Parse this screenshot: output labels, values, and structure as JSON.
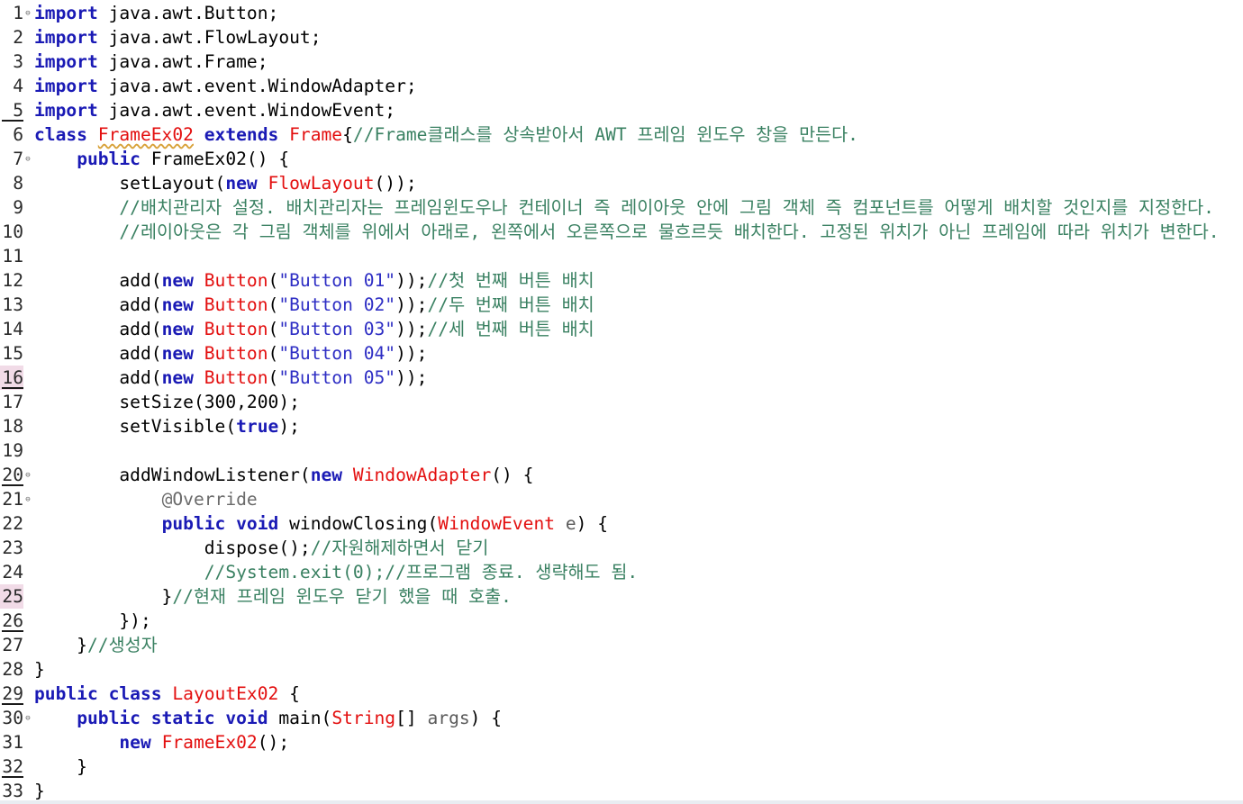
{
  "editor": {
    "language": "java",
    "lines": [
      {
        "n": "1",
        "fold": true,
        "segs": [
          {
            "t": "import",
            "c": "kw"
          },
          {
            "t": " java.awt.Button;",
            "c": ""
          }
        ]
      },
      {
        "n": "2",
        "segs": [
          {
            "t": "import",
            "c": "kw"
          },
          {
            "t": " java.awt.FlowLayout;",
            "c": ""
          }
        ]
      },
      {
        "n": "3",
        "segs": [
          {
            "t": "import",
            "c": "kw"
          },
          {
            "t": " java.awt.Frame;",
            "c": ""
          }
        ]
      },
      {
        "n": "4",
        "segs": [
          {
            "t": "import",
            "c": "kw"
          },
          {
            "t": " java.awt.event.WindowAdapter;",
            "c": ""
          }
        ]
      },
      {
        "n": "5",
        "underline": true,
        "segs": [
          {
            "t": "import",
            "c": "kw"
          },
          {
            "t": " java.awt.event.WindowEvent;",
            "c": ""
          }
        ]
      },
      {
        "n": "6",
        "segs": [
          {
            "t": "class",
            "c": "kw"
          },
          {
            "t": " ",
            "c": ""
          },
          {
            "t": "FrameEx02",
            "c": "ty err"
          },
          {
            "t": " ",
            "c": ""
          },
          {
            "t": "extends",
            "c": "kw"
          },
          {
            "t": " ",
            "c": ""
          },
          {
            "t": "Frame",
            "c": "ty"
          },
          {
            "t": "{",
            "c": ""
          },
          {
            "t": "//Frame클래스를 상속받아서 AWT 프레임 윈도우 창을 만든다.",
            "c": "cm"
          }
        ]
      },
      {
        "n": "7",
        "fold": true,
        "segs": [
          {
            "t": "    ",
            "c": ""
          },
          {
            "t": "public",
            "c": "kw"
          },
          {
            "t": " FrameEx02() {",
            "c": ""
          }
        ]
      },
      {
        "n": "8",
        "segs": [
          {
            "t": "        setLayout(",
            "c": ""
          },
          {
            "t": "new",
            "c": "kw"
          },
          {
            "t": " ",
            "c": ""
          },
          {
            "t": "FlowLayout",
            "c": "ty"
          },
          {
            "t": "());",
            "c": ""
          }
        ]
      },
      {
        "n": "9",
        "segs": [
          {
            "t": "        ",
            "c": ""
          },
          {
            "t": "//배치관리자 설정. 배치관리자는 프레임윈도우나 컨테이너 즉 레이아웃 안에 그림 객체 즉 컴포넌트를 어떻게 배치할 것인지를 지정한다.",
            "c": "cm"
          }
        ]
      },
      {
        "n": "10",
        "segs": [
          {
            "t": "        ",
            "c": ""
          },
          {
            "t": "//레이아웃은 각 그림 객체를 위에서 아래로, 왼쪽에서 오른쪽으로 물흐르듯 배치한다. 고정된 위치가 아닌 프레임에 따라 위치가 변한다.",
            "c": "cm"
          }
        ]
      },
      {
        "n": "11",
        "segs": []
      },
      {
        "n": "12",
        "segs": [
          {
            "t": "        add(",
            "c": ""
          },
          {
            "t": "new",
            "c": "kw"
          },
          {
            "t": " ",
            "c": ""
          },
          {
            "t": "Button",
            "c": "ty"
          },
          {
            "t": "(",
            "c": ""
          },
          {
            "t": "\"Button 01\"",
            "c": "st"
          },
          {
            "t": "));",
            "c": ""
          },
          {
            "t": "//첫 번째 버튼 배치",
            "c": "cm"
          }
        ]
      },
      {
        "n": "13",
        "segs": [
          {
            "t": "        add(",
            "c": ""
          },
          {
            "t": "new",
            "c": "kw"
          },
          {
            "t": " ",
            "c": ""
          },
          {
            "t": "Button",
            "c": "ty"
          },
          {
            "t": "(",
            "c": ""
          },
          {
            "t": "\"Button 02\"",
            "c": "st"
          },
          {
            "t": "));",
            "c": ""
          },
          {
            "t": "//두 번째 버튼 배치",
            "c": "cm"
          }
        ]
      },
      {
        "n": "14",
        "segs": [
          {
            "t": "        add(",
            "c": ""
          },
          {
            "t": "new",
            "c": "kw"
          },
          {
            "t": " ",
            "c": ""
          },
          {
            "t": "Button",
            "c": "ty"
          },
          {
            "t": "(",
            "c": ""
          },
          {
            "t": "\"Button 03\"",
            "c": "st"
          },
          {
            "t": "));",
            "c": ""
          },
          {
            "t": "//세 번째 버튼 배치",
            "c": "cm"
          }
        ]
      },
      {
        "n": "15",
        "segs": [
          {
            "t": "        add(",
            "c": ""
          },
          {
            "t": "new",
            "c": "kw"
          },
          {
            "t": " ",
            "c": ""
          },
          {
            "t": "Button",
            "c": "ty"
          },
          {
            "t": "(",
            "c": ""
          },
          {
            "t": "\"Button 04\"",
            "c": "st"
          },
          {
            "t": "));",
            "c": ""
          }
        ]
      },
      {
        "n": "16",
        "bookmark": true,
        "underline": true,
        "segs": [
          {
            "t": "        add(",
            "c": ""
          },
          {
            "t": "new",
            "c": "kw"
          },
          {
            "t": " ",
            "c": ""
          },
          {
            "t": "Button",
            "c": "ty"
          },
          {
            "t": "(",
            "c": ""
          },
          {
            "t": "\"Button 05\"",
            "c": "st"
          },
          {
            "t": "));",
            "c": ""
          }
        ]
      },
      {
        "n": "17",
        "segs": [
          {
            "t": "        setSize(300,200);",
            "c": ""
          }
        ]
      },
      {
        "n": "18",
        "segs": [
          {
            "t": "        setVisible(",
            "c": ""
          },
          {
            "t": "true",
            "c": "kw"
          },
          {
            "t": ");",
            "c": ""
          }
        ]
      },
      {
        "n": "19",
        "segs": []
      },
      {
        "n": "20",
        "fold": true,
        "underline": true,
        "segs": [
          {
            "t": "        addWindowListener(",
            "c": ""
          },
          {
            "t": "new",
            "c": "kw"
          },
          {
            "t": " ",
            "c": ""
          },
          {
            "t": "WindowAdapter",
            "c": "ty"
          },
          {
            "t": "() {",
            "c": ""
          }
        ]
      },
      {
        "n": "21",
        "fold": true,
        "segs": [
          {
            "t": "            ",
            "c": ""
          },
          {
            "t": "@Override",
            "c": "an"
          }
        ]
      },
      {
        "n": "22",
        "segs": [
          {
            "t": "            ",
            "c": ""
          },
          {
            "t": "public",
            "c": "kw"
          },
          {
            "t": " ",
            "c": ""
          },
          {
            "t": "void",
            "c": "kw"
          },
          {
            "t": " windowClosing(",
            "c": ""
          },
          {
            "t": "WindowEvent",
            "c": "ty"
          },
          {
            "t": " ",
            "c": ""
          },
          {
            "t": "e",
            "c": "pa"
          },
          {
            "t": ") {",
            "c": ""
          }
        ]
      },
      {
        "n": "23",
        "segs": [
          {
            "t": "                dispose();",
            "c": ""
          },
          {
            "t": "//자원해제하면서 닫기",
            "c": "cm"
          }
        ]
      },
      {
        "n": "24",
        "segs": [
          {
            "t": "                ",
            "c": ""
          },
          {
            "t": "//System.exit(0);//프로그램 종료. 생략해도 됨.",
            "c": "cm"
          }
        ]
      },
      {
        "n": "25",
        "bookmark": true,
        "segs": [
          {
            "t": "            }",
            "c": ""
          },
          {
            "t": "//현재 프레임 윈도우 닫기 했을 때 호출.",
            "c": "cm"
          }
        ]
      },
      {
        "n": "26",
        "underline": true,
        "segs": [
          {
            "t": "        });",
            "c": ""
          }
        ]
      },
      {
        "n": "27",
        "segs": [
          {
            "t": "    }",
            "c": ""
          },
          {
            "t": "//생성자",
            "c": "cm"
          }
        ]
      },
      {
        "n": "28",
        "segs": [
          {
            "t": "}",
            "c": ""
          }
        ]
      },
      {
        "n": "29",
        "underline": true,
        "segs": [
          {
            "t": "public",
            "c": "kw"
          },
          {
            "t": " ",
            "c": ""
          },
          {
            "t": "class",
            "c": "kw"
          },
          {
            "t": " ",
            "c": ""
          },
          {
            "t": "LayoutEx02",
            "c": "ty"
          },
          {
            "t": " {",
            "c": ""
          }
        ]
      },
      {
        "n": "30",
        "fold": true,
        "segs": [
          {
            "t": "    ",
            "c": ""
          },
          {
            "t": "public",
            "c": "kw"
          },
          {
            "t": " ",
            "c": ""
          },
          {
            "t": "static",
            "c": "kw"
          },
          {
            "t": " ",
            "c": ""
          },
          {
            "t": "void",
            "c": "kw"
          },
          {
            "t": " main(",
            "c": ""
          },
          {
            "t": "String",
            "c": "ty"
          },
          {
            "t": "[] ",
            "c": ""
          },
          {
            "t": "args",
            "c": "pa"
          },
          {
            "t": ") {",
            "c": ""
          }
        ]
      },
      {
        "n": "31",
        "segs": [
          {
            "t": "        ",
            "c": ""
          },
          {
            "t": "new",
            "c": "kw"
          },
          {
            "t": " ",
            "c": ""
          },
          {
            "t": "FrameEx02",
            "c": "ty"
          },
          {
            "t": "();",
            "c": ""
          }
        ]
      },
      {
        "n": "32",
        "underline": true,
        "segs": [
          {
            "t": "    }",
            "c": ""
          }
        ]
      },
      {
        "n": "33",
        "segs": [
          {
            "t": "}",
            "c": ""
          }
        ]
      }
    ]
  }
}
